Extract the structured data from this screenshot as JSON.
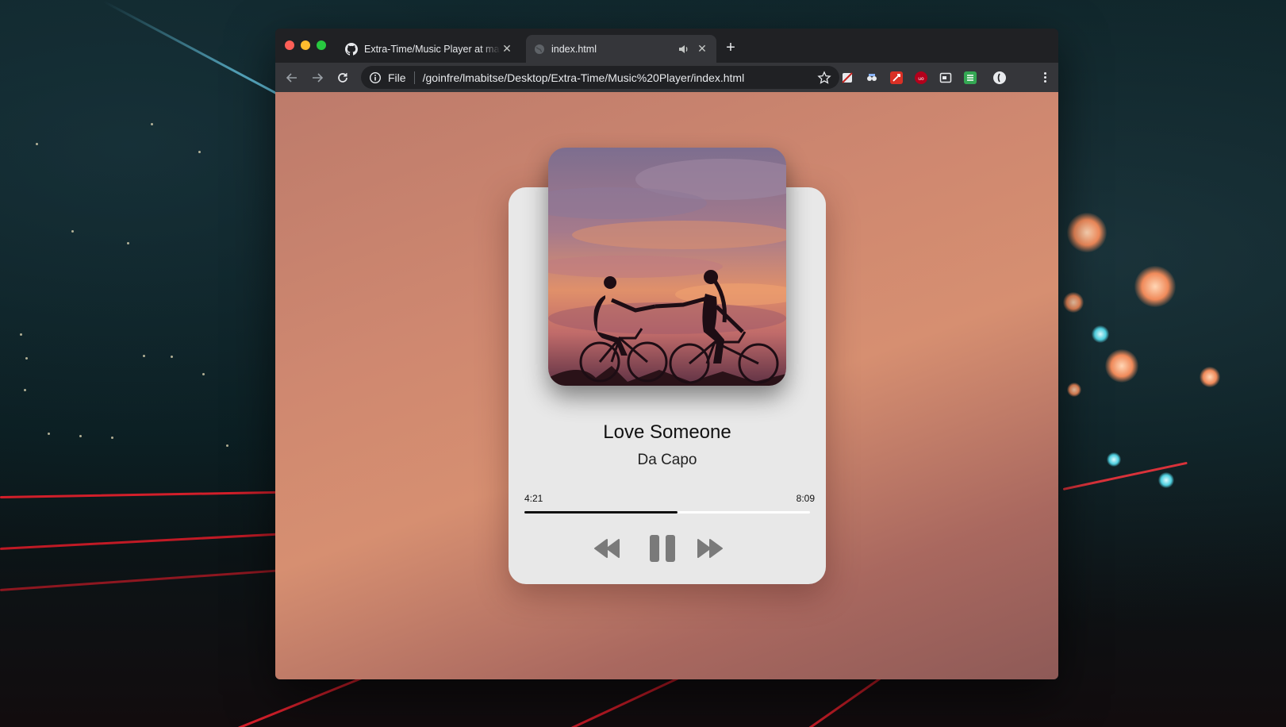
{
  "browser": {
    "tabs": [
      {
        "title": "Extra-Time/Music Player at master · goinfre",
        "active": false,
        "icon": "github-icon"
      },
      {
        "title": "index.html",
        "active": true,
        "icon": "globe-icon",
        "muted_indicator": "speaker-icon"
      }
    ],
    "address_bar": {
      "scheme_label": "File",
      "url": "/goinfre/lmabitse/Desktop/Extra-Time/Music%20Player/index.html"
    }
  },
  "player": {
    "title": "Love Someone",
    "artist": "Da Capo",
    "current_time": "4:21",
    "duration": "8:09",
    "progress": 0.535,
    "state": "playing",
    "controls": [
      "backward-icon",
      "pause-icon",
      "forward-icon"
    ]
  },
  "colors": {
    "card": "#e8e8e8",
    "progress_track": "#ffffff",
    "progress_fill": "#111111",
    "controls": "#7a7a7a"
  }
}
